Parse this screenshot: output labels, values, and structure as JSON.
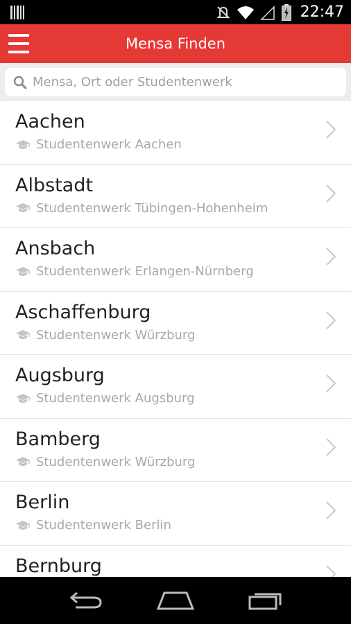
{
  "status_bar": {
    "time": "22:47",
    "icons": [
      "barcode-icon",
      "mute-icon",
      "wifi-icon",
      "signal-icon",
      "battery-icon"
    ]
  },
  "app_bar": {
    "title": "Mensa Finden",
    "menu_icon": "menu-icon",
    "color": "#e53935"
  },
  "search": {
    "placeholder": "Mensa, Ort oder Studentenwerk"
  },
  "list": {
    "items": [
      {
        "city": "Aachen",
        "studentenwerk": "Studentenwerk Aachen"
      },
      {
        "city": "Albstadt",
        "studentenwerk": "Studentenwerk Tübingen-Hohenheim"
      },
      {
        "city": "Ansbach",
        "studentenwerk": "Studentenwerk Erlangen-Nürnberg"
      },
      {
        "city": "Aschaffenburg",
        "studentenwerk": "Studentenwerk Würzburg"
      },
      {
        "city": "Augsburg",
        "studentenwerk": "Studentenwerk Augsburg"
      },
      {
        "city": "Bamberg",
        "studentenwerk": "Studentenwerk Würzburg"
      },
      {
        "city": "Berlin",
        "studentenwerk": "Studentenwerk Berlin"
      },
      {
        "city": "Bernburg",
        "studentenwerk": ""
      }
    ]
  },
  "nav_bar": {
    "buttons": [
      "back-icon",
      "home-icon",
      "recents-icon"
    ]
  }
}
